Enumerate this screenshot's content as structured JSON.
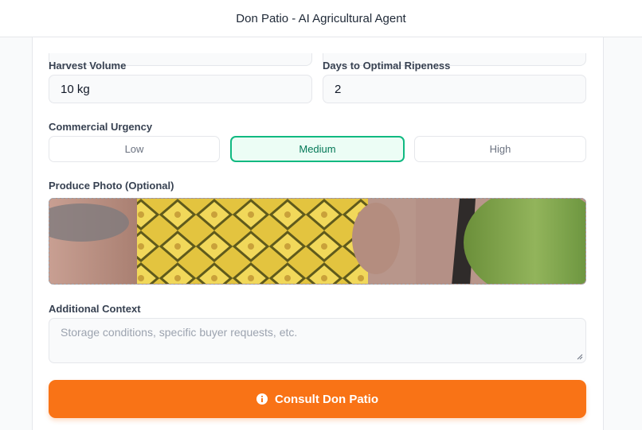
{
  "header": {
    "title": "Don Patio - AI Agricultural Agent"
  },
  "form": {
    "harvest_volume": {
      "label": "Harvest Volume",
      "value": "10 kg"
    },
    "days_to_ripeness": {
      "label": "Days to Optimal Ripeness",
      "value": "2"
    },
    "urgency": {
      "label": "Commercial Urgency",
      "options": [
        "Low",
        "Medium",
        "High"
      ],
      "selected": "Medium"
    },
    "photo": {
      "label": "Produce Photo (Optional)"
    },
    "context": {
      "label": "Additional Context",
      "placeholder": "Storage conditions, specific buyer requests, etc."
    },
    "submit": {
      "label": "Consult Don Patio",
      "icon": "info-icon"
    }
  },
  "colors": {
    "accent": "#f97316",
    "selected_border": "#10b981",
    "selected_bg": "#ecfdf5"
  }
}
